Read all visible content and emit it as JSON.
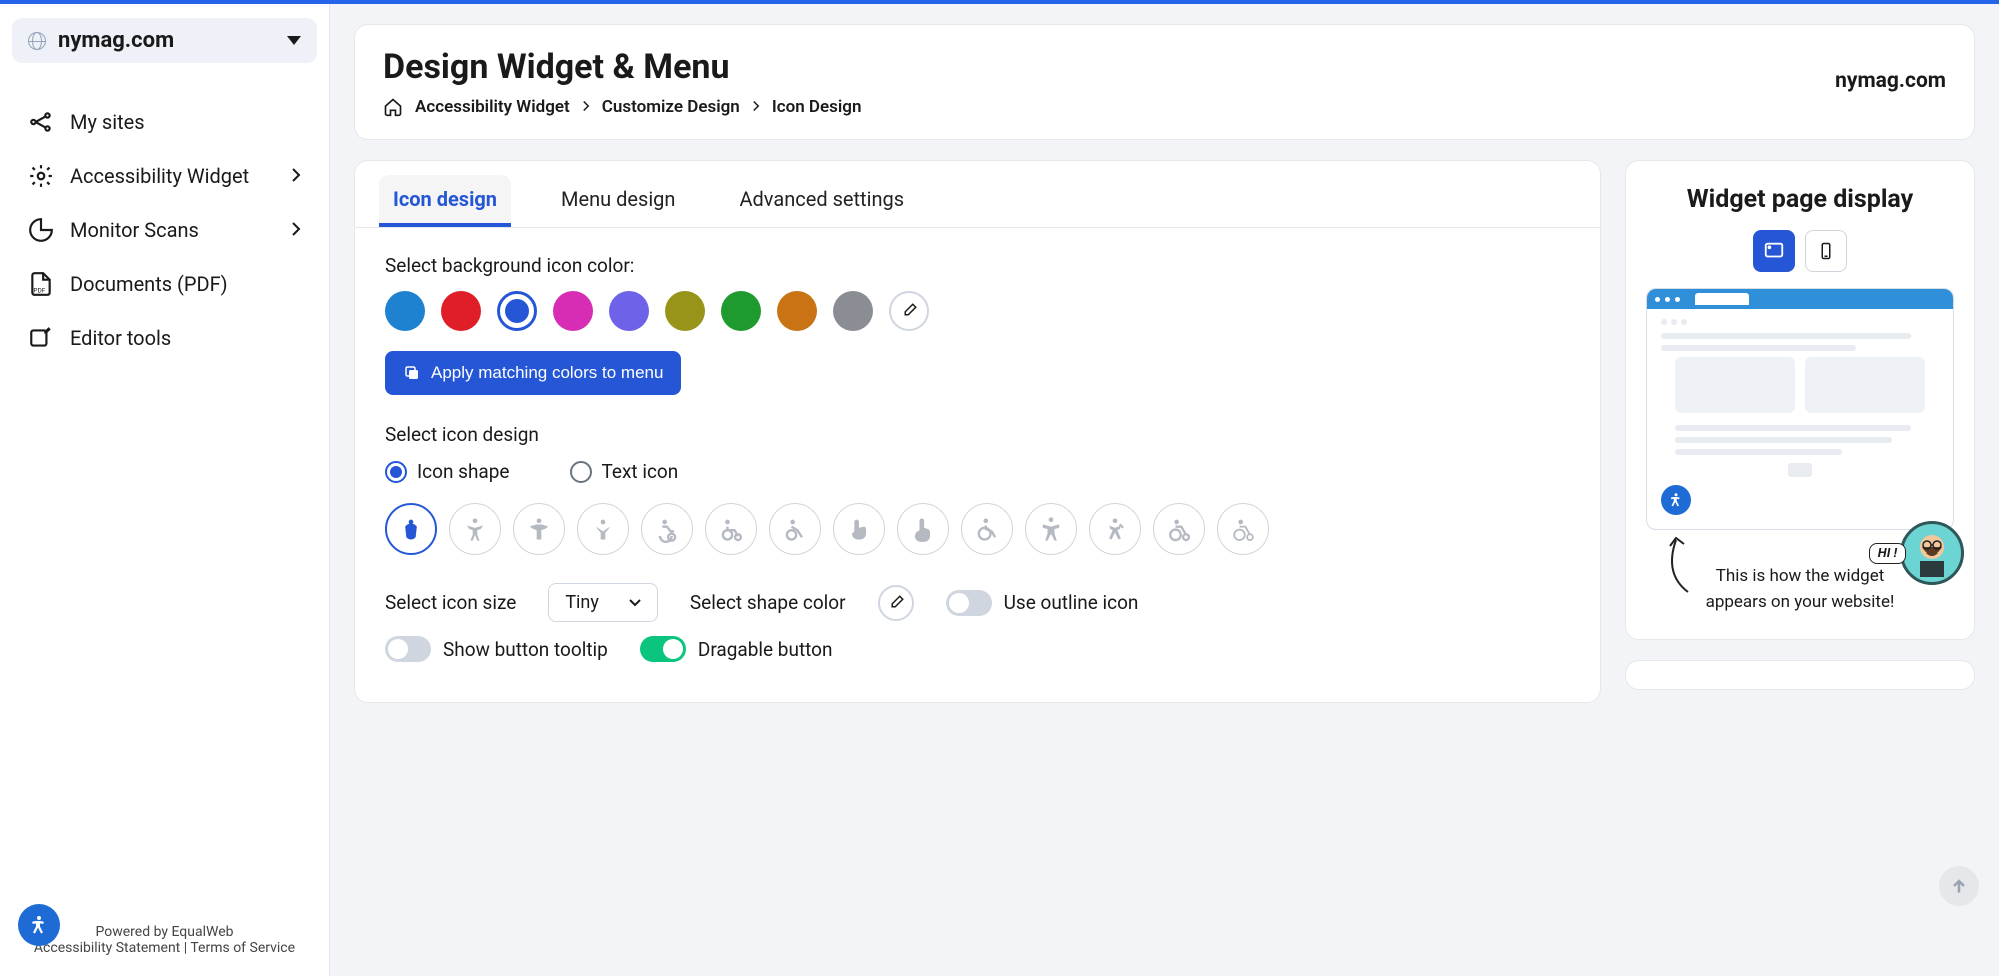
{
  "site": {
    "name": "nymag.com"
  },
  "nav": {
    "mySites": "My sites",
    "accessibilityWidget": "Accessibility Widget",
    "monitorScans": "Monitor Scans",
    "documentsPdf": "Documents (PDF)",
    "editorTools": "Editor tools"
  },
  "footer": {
    "poweredBy": "Powered by EqualWeb",
    "accStatement": "Accessibility Statement",
    "tos": "Terms of Service"
  },
  "header": {
    "title": "Design Widget & Menu",
    "domain": "nymag.com",
    "breadcrumb": [
      "Accessibility Widget",
      "Customize Design",
      "Icon Design"
    ]
  },
  "tabs": [
    "Icon design",
    "Menu design",
    "Advanced settings"
  ],
  "sections": {
    "bgColorLabel": "Select background icon color:",
    "applyBtn": "Apply matching colors to menu",
    "iconDesignLabel": "Select icon design",
    "iconShape": "Icon shape",
    "textIcon": "Text icon",
    "sizeLabel": "Select icon size",
    "sizeValue": "Tiny",
    "shapeColorLabel": "Select shape color",
    "outlineLabel": "Use outline icon",
    "tooltipLabel": "Show button tooltip",
    "dragLabel": "Dragable button"
  },
  "colors": {
    "swatches": [
      "#1e82d0",
      "#e01e28",
      "#2456d6",
      "#d62db4",
      "#6e62e8",
      "#98941a",
      "#1f9a2e",
      "#c97314",
      "#8a8e94"
    ],
    "selectedIndex": 2
  },
  "preview": {
    "title": "Widget page display",
    "hint1": "This is how the widget",
    "hint2": "appears on your website!",
    "hi": "HI !"
  }
}
